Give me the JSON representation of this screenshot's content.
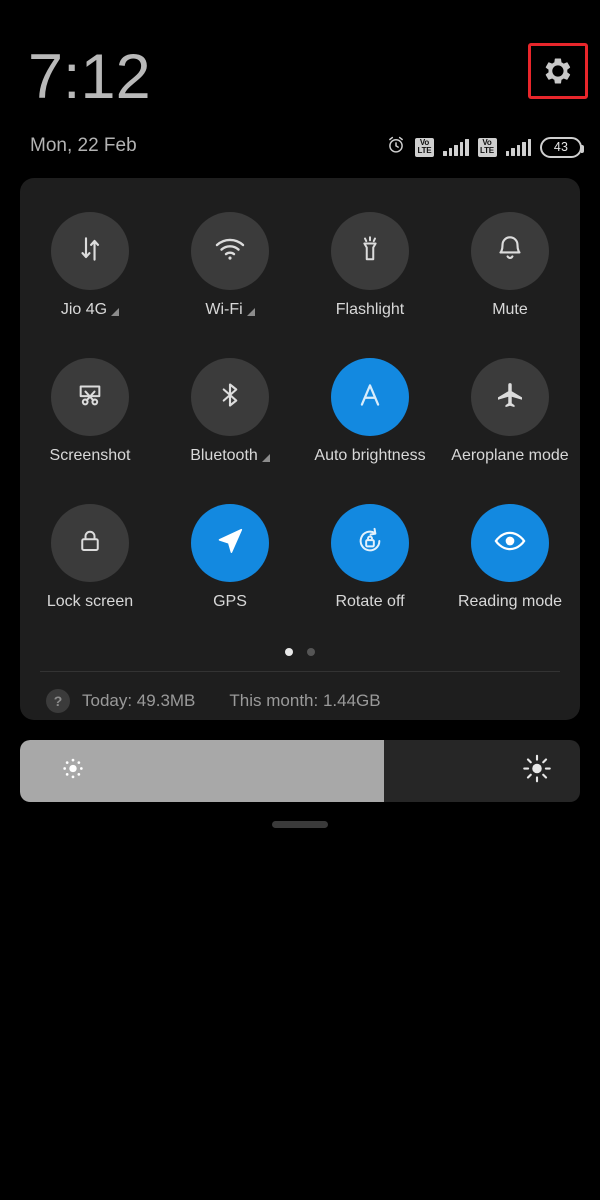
{
  "header": {
    "clock": "7:12",
    "date": "Mon, 22 Feb",
    "settings_icon": "gear-icon",
    "settings_highlight_color": "#e8262b"
  },
  "statusbar": {
    "alarm_icon": "alarm-clock-icon",
    "sims": [
      {
        "volte_top": "Vo",
        "volte_bottom": "LTE",
        "signal_bars": 5
      },
      {
        "volte_top": "Vo",
        "volte_bottom": "LTE",
        "signal_bars": 5
      }
    ],
    "battery_level": "43"
  },
  "quick_settings": {
    "accent_on_color": "#1389e0",
    "tile_off_color": "#3b3b3b",
    "tiles": [
      {
        "label": "Jio 4G",
        "icon": "mobile-data-icon",
        "active": false,
        "expandable": true
      },
      {
        "label": "Wi-Fi",
        "icon": "wifi-icon",
        "active": false,
        "expandable": true
      },
      {
        "label": "Flashlight",
        "icon": "flashlight-icon",
        "active": false,
        "expandable": false
      },
      {
        "label": "Mute",
        "icon": "bell-icon",
        "active": false,
        "expandable": false
      },
      {
        "label": "Screenshot",
        "icon": "screenshot-icon",
        "active": false,
        "expandable": false
      },
      {
        "label": "Bluetooth",
        "icon": "bluetooth-icon",
        "active": false,
        "expandable": true
      },
      {
        "label": "Auto brightness",
        "icon": "auto-brightness-icon",
        "active": true,
        "expandable": false
      },
      {
        "label": "Aeroplane mode",
        "icon": "aeroplane-icon",
        "active": false,
        "expandable": false
      },
      {
        "label": "Lock screen",
        "icon": "padlock-icon",
        "active": false,
        "expandable": false
      },
      {
        "label": "GPS",
        "icon": "navigation-arrow-icon",
        "active": true,
        "expandable": false
      },
      {
        "label": "Rotate off",
        "icon": "rotation-lock-icon",
        "active": true,
        "expandable": false
      },
      {
        "label": "Reading mode",
        "icon": "eye-icon",
        "active": true,
        "expandable": false
      }
    ],
    "pages": {
      "count": 2,
      "active_index": 0
    }
  },
  "data_usage": {
    "help_icon": "question-mark-icon",
    "today_label": "Today: 49.3MB",
    "month_label": "This month: 1.44GB"
  },
  "brightness": {
    "level_percent": 65,
    "low_icon": "sun-dim-icon",
    "high_icon": "sun-bright-icon"
  },
  "pull_handle": {
    "name": "panel-pull-handle"
  }
}
